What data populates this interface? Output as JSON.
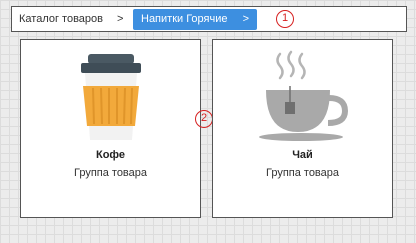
{
  "breadcrumb": {
    "items": [
      {
        "label": "Каталог товаров"
      },
      {
        "label": "Напитки Горячие"
      }
    ],
    "separator": ">"
  },
  "markers": [
    "1",
    "2"
  ],
  "cards": [
    {
      "title": "Кофе",
      "subtitle": "Группа товара",
      "icon": "coffee-cup-icon"
    },
    {
      "title": "Чай",
      "subtitle": "Группа товара",
      "icon": "tea-cup-icon"
    }
  ],
  "colors": {
    "active_crumb": "#3d8fe0",
    "marker": "#d62020",
    "coffee_sleeve": "#f2a93b",
    "coffee_lid": "#4a5963",
    "tea_cup": "#a9a9a9"
  }
}
